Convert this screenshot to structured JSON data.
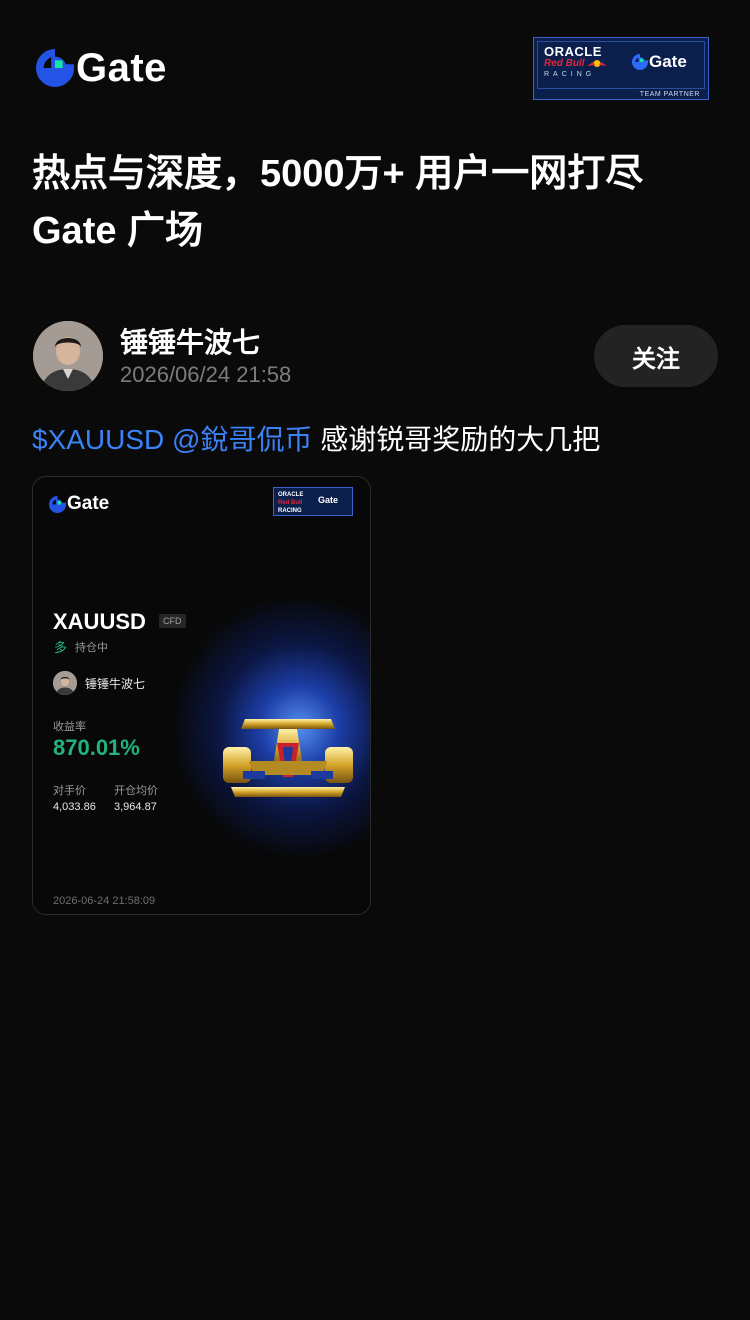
{
  "header": {
    "logo_text": "Gate",
    "logo_icon": "gate-logo-icon",
    "partner": {
      "oracle": "ORACLE",
      "redbull": "Red Bull",
      "racing": "RACING",
      "gate": "Gate",
      "team": "TEAM PARTNER"
    }
  },
  "headline": {
    "line1": "热点与深度，5000万+ 用户一网打尽",
    "line2": "Gate 广场"
  },
  "post": {
    "author": "锤锤牛波七",
    "time": "2026/06/24 21:58",
    "follow_label": "关注",
    "link_symbol": "$XAUUSD",
    "link_mention": "@銳哥侃币",
    "text": " 感谢锐哥奖励的大几把"
  },
  "card": {
    "logo_text": "Gate",
    "symbol": "XAUUSD",
    "instrument_tag": "CFD",
    "side": "多",
    "status": "持仓中",
    "user": "锤锤牛波七",
    "yield_label": "收益率",
    "yield_value": "870.01%",
    "mark_price_label": "对手价",
    "mark_price_value": "4,033.86",
    "entry_price_label": "开仓均价",
    "entry_price_value": "3,964.87",
    "timestamp": "2026-06-24 21:58:09",
    "badge_oracle": "ORACLE",
    "badge_redbull": "Red Bull",
    "badge_racing": "RACING",
    "badge_gate": "Gate",
    "image": "gold-f1-car-image"
  },
  "colors": {
    "background": "#0a0a0a",
    "link": "#3b82f6",
    "positive": "#22b37c",
    "gate_blue": "#2354e6",
    "gate_green": "#17e6a1"
  }
}
